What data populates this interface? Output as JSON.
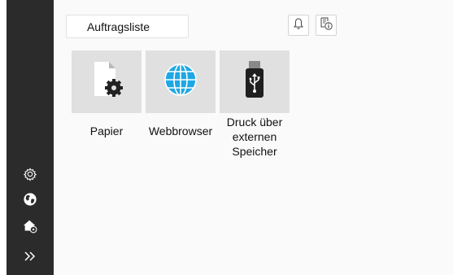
{
  "header": {
    "job_list_label": "Auftragsliste",
    "notification_icon": "bell-icon",
    "job_info_icon": "job-info-icon"
  },
  "tiles": [
    {
      "label": "Papier",
      "icon": "paper-settings-icon"
    },
    {
      "label": "Webbrowser",
      "icon": "globe-icon"
    },
    {
      "label": "Druck über\nexternen\nSpeicher",
      "icon": "usb-drive-icon"
    }
  ],
  "sidebar": {
    "icons": [
      "settings-icon",
      "globe-icon",
      "home-settings-icon",
      "double-chevron-right-icon"
    ]
  },
  "colors": {
    "sidebar_bg": "#2b2b2b",
    "tile_bg": "#e0e0e0",
    "globe_blue": "#1ea7e4",
    "main_bg": "#fafafa"
  }
}
